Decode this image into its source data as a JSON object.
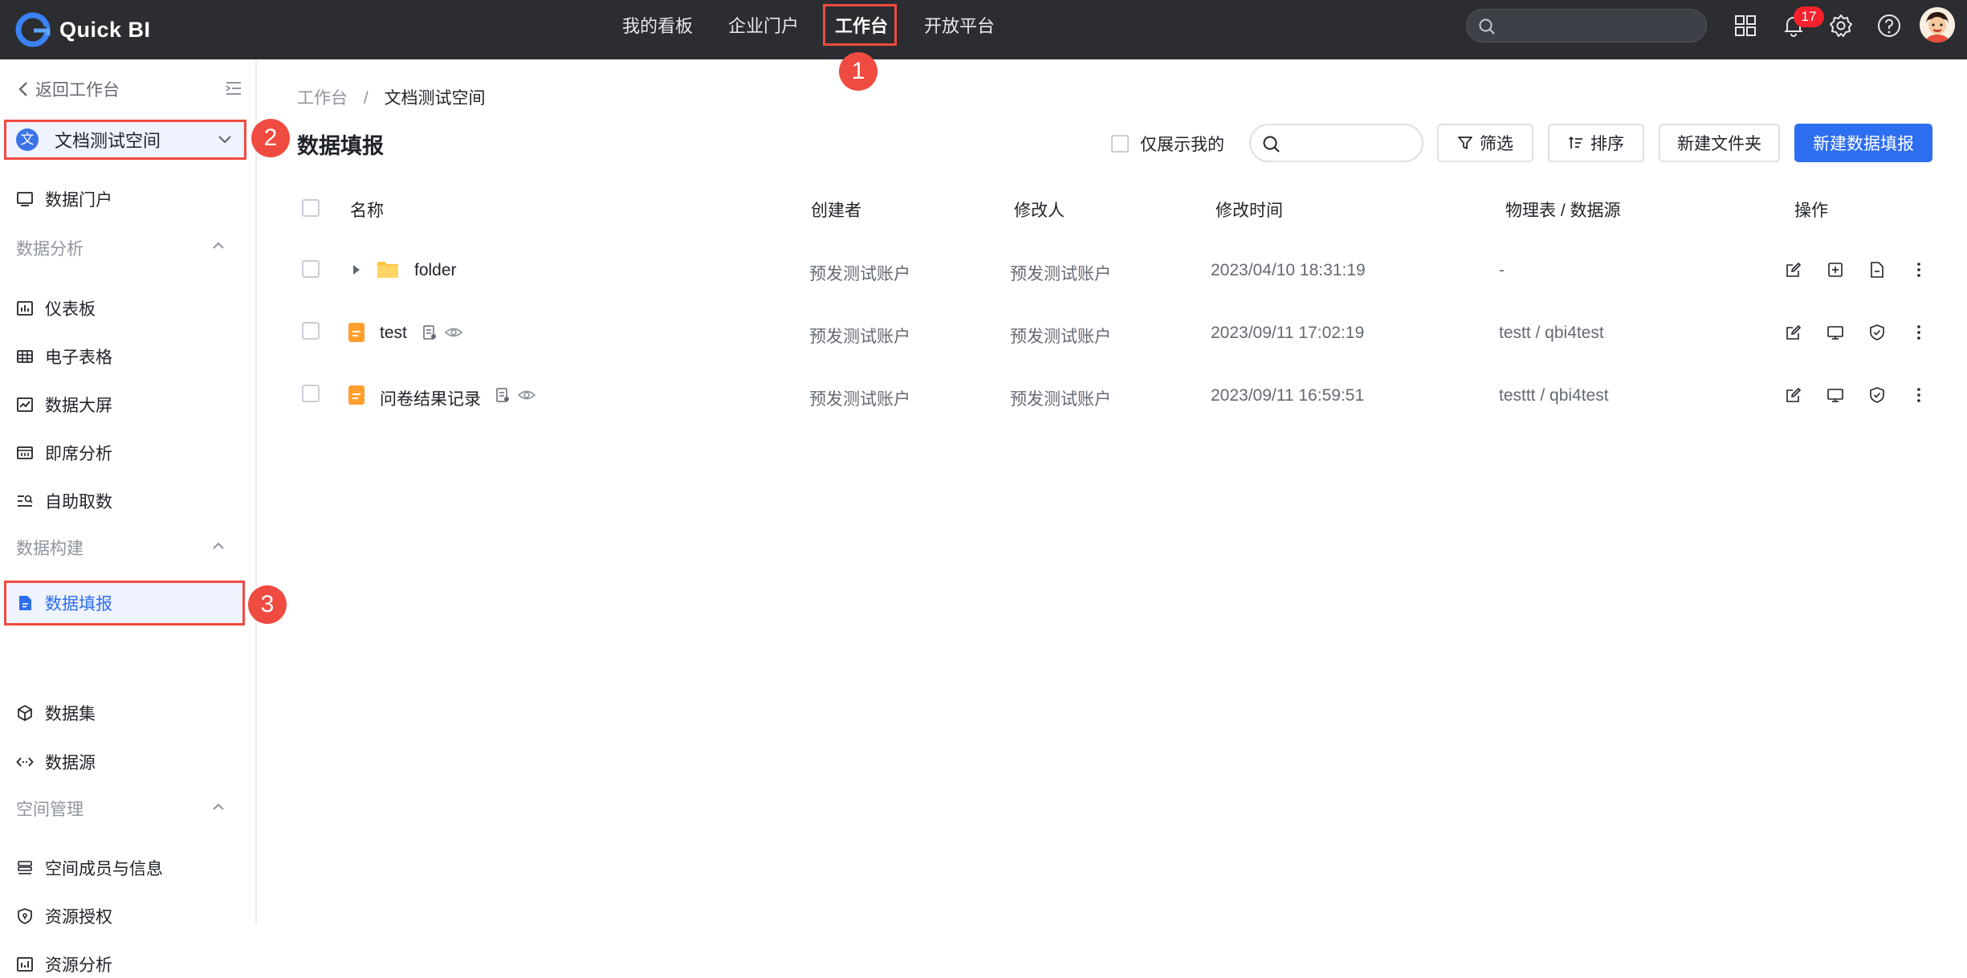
{
  "app": {
    "name": "Quick BI"
  },
  "topnav": {
    "items": [
      {
        "label": "我的看板"
      },
      {
        "label": "企业门户"
      },
      {
        "label": "工作台"
      },
      {
        "label": "开放平台"
      }
    ],
    "active": "工作台",
    "notification_count": "17",
    "search_placeholder": ""
  },
  "callouts": [
    "1",
    "2",
    "3"
  ],
  "sidebar": {
    "back_label": "返回工作台",
    "space_badge": "文",
    "space_name": "文档测试空间",
    "portal": "数据门户",
    "groups": [
      {
        "label": "数据分析",
        "items": [
          "仪表板",
          "电子表格",
          "数据大屏",
          "即席分析",
          "自助取数"
        ]
      },
      {
        "label": "数据构建",
        "items": [
          "数据填报",
          "数据集",
          "数据源"
        ]
      },
      {
        "label": "空间管理",
        "items": [
          "空间成员与信息",
          "资源授权",
          "资源分析"
        ]
      }
    ],
    "active_item": "数据填报"
  },
  "breadcrumb": {
    "root": "工作台",
    "separator": "/",
    "current": "文档测试空间"
  },
  "page": {
    "title": "数据填报",
    "only_mine_label": "仅展示我的",
    "filter_label": "筛选",
    "sort_label": "排序",
    "new_folder_label": "新建文件夹",
    "new_form_label": "新建数据填报"
  },
  "table": {
    "columns": [
      "名称",
      "创建者",
      "修改人",
      "修改时间",
      "物理表 / 数据源",
      "操作"
    ],
    "rows": [
      {
        "type": "folder",
        "name": "folder",
        "creator": "预发测试账户",
        "modifier": "预发测试账户",
        "modified": "2023/04/10 18:31:19",
        "source": "-"
      },
      {
        "type": "form",
        "name": "test",
        "creator": "预发测试账户",
        "modifier": "预发测试账户",
        "modified": "2023/09/11 17:02:19",
        "source": "testt / qbi4test"
      },
      {
        "type": "form",
        "name": "问卷结果记录",
        "creator": "预发测试账户",
        "modifier": "预发测试账户",
        "modified": "2023/09/11 16:59:51",
        "source": "testtt / qbi4test"
      }
    ]
  },
  "colors": {
    "accent": "#2e6ef0",
    "topbar": "#2b2d31",
    "highlight": "#f04b41",
    "folder": "#ffc53d",
    "form": "#ff9f2d"
  }
}
